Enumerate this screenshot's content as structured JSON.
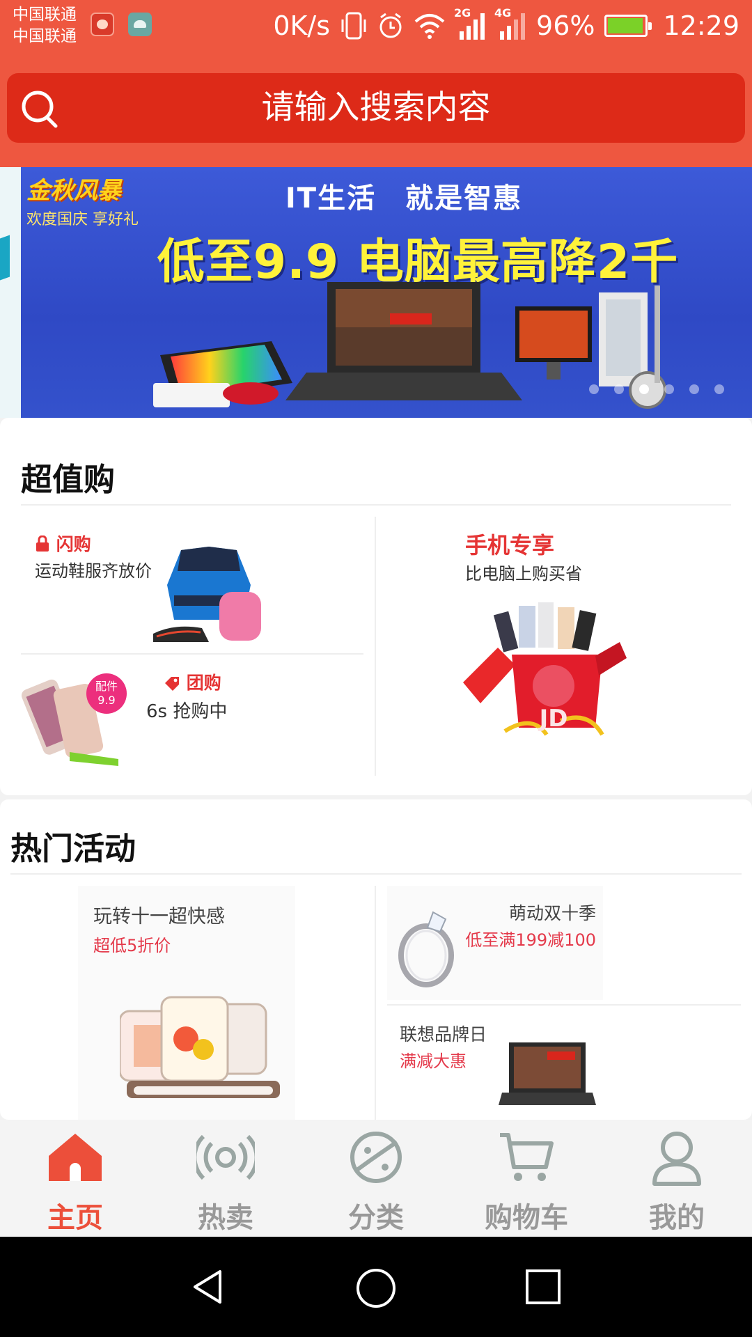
{
  "status_bar": {
    "carrier1": "中国联通",
    "carrier2": "中国联通",
    "net_speed": "0K/s",
    "net1": "2G",
    "net2": "4G",
    "battery_text": "96%",
    "battery_level": 0.96,
    "time": "12:29"
  },
  "search": {
    "placeholder": "请输入搜索内容"
  },
  "banner": {
    "brand": "金秋风暴",
    "brand_sub": "欢度国庆 享好礼",
    "headline": "IT生活　就是智惠",
    "promo": "低至9.9 电脑最高降2千",
    "slides_count": 6,
    "active_slide": 3
  },
  "section1": {
    "title": "超值购",
    "flash": {
      "title": "闪购",
      "subtitle": "运动鞋服齐放价"
    },
    "group": {
      "title": "团购",
      "subtitle": "6s 抢购中",
      "badge_line1": "配件",
      "badge_line2": "9.9"
    },
    "mobile": {
      "title": "手机专享",
      "subtitle": "比电脑上购买省",
      "logo_text": "JD"
    }
  },
  "section2": {
    "title": "热门活动",
    "kettle": {
      "title": "玩转十一超快感",
      "subtitle": "超低5折价"
    },
    "ring": {
      "title": "萌动双十季",
      "subtitle": "低至满199减100"
    },
    "lenovo": {
      "title": "联想品牌日",
      "subtitle": "满减大惠"
    }
  },
  "bottom_nav": {
    "items": [
      {
        "label": "主页",
        "icon": "home-icon",
        "active": true
      },
      {
        "label": "热卖",
        "icon": "broadcast-icon",
        "active": false
      },
      {
        "label": "分类",
        "icon": "planet-icon",
        "active": false
      },
      {
        "label": "购物车",
        "icon": "cart-icon",
        "active": false
      },
      {
        "label": "我的",
        "icon": "user-icon",
        "active": false
      }
    ]
  },
  "colors": {
    "accent": "#ee5740",
    "search_bg": "#dd2a18",
    "active_tab": "#ec4f3a",
    "inactive_tab": "#999999"
  }
}
